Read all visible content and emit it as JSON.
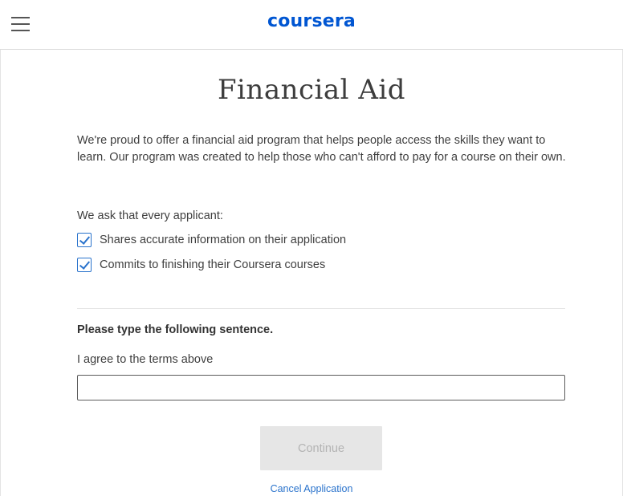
{
  "header": {
    "logo_text": "coursera",
    "brand_color": "#0056d2",
    "menu_icon": "hamburger-icon"
  },
  "main": {
    "title": "Financial Aid",
    "intro": "We're proud to offer a financial aid program that helps people access the skills they want to learn. Our program was created to help those who can't afford to pay for a course on their own.",
    "ask_label": "We ask that every applicant:",
    "commitments": [
      {
        "label": "Shares accurate information on their application",
        "checked": true
      },
      {
        "label": "Commits to finishing their Coursera courses",
        "checked": true
      }
    ],
    "type_heading": "Please type the following sentence.",
    "sentence": "I agree to the terms above",
    "agree_input": {
      "value": "",
      "placeholder": ""
    },
    "continue_label": "Continue",
    "continue_enabled": false,
    "cancel_label": "Cancel Application"
  }
}
